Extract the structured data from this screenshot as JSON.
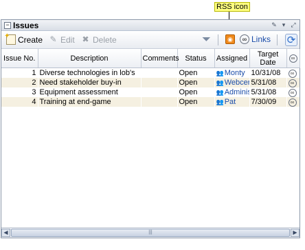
{
  "callout": {
    "label": "RSS icon"
  },
  "panel": {
    "title": "Issues",
    "collapse_symbol": "−",
    "controls": [
      "pencil-icon",
      "chevron-down-icon",
      "maximize-icon"
    ]
  },
  "toolbar": {
    "create_label": "Create",
    "edit_label": "Edit",
    "delete_label": "Delete",
    "links_label": "Links"
  },
  "table": {
    "columns": [
      "Issue No.",
      "Description",
      "Comments",
      "Status",
      "Assigned",
      "Target Date",
      ""
    ],
    "rows": [
      {
        "num": "1",
        "description": "Diverse technologies in lob's",
        "comments": "",
        "status": "Open",
        "assigned": "Monty",
        "date": "10/31/08"
      },
      {
        "num": "2",
        "description": "Need stakeholder buy-in",
        "comments": "",
        "status": "Open",
        "assigned": "Webcer",
        "date": "5/31/08"
      },
      {
        "num": "3",
        "description": "Equipment assessment",
        "comments": "",
        "status": "Open",
        "assigned": "Adminis",
        "date": "5/31/08"
      },
      {
        "num": "4",
        "description": "Training at end-game",
        "comments": "",
        "status": "Open",
        "assigned": "Pat",
        "date": "7/30/09"
      }
    ]
  },
  "scrollbar": {
    "left_arrow": "◀",
    "right_arrow": "▶",
    "grip": "|||"
  },
  "colors": {
    "alt_row": "#f5f0e1",
    "link": "#1a4ca8",
    "rss": "#f08a1c"
  }
}
